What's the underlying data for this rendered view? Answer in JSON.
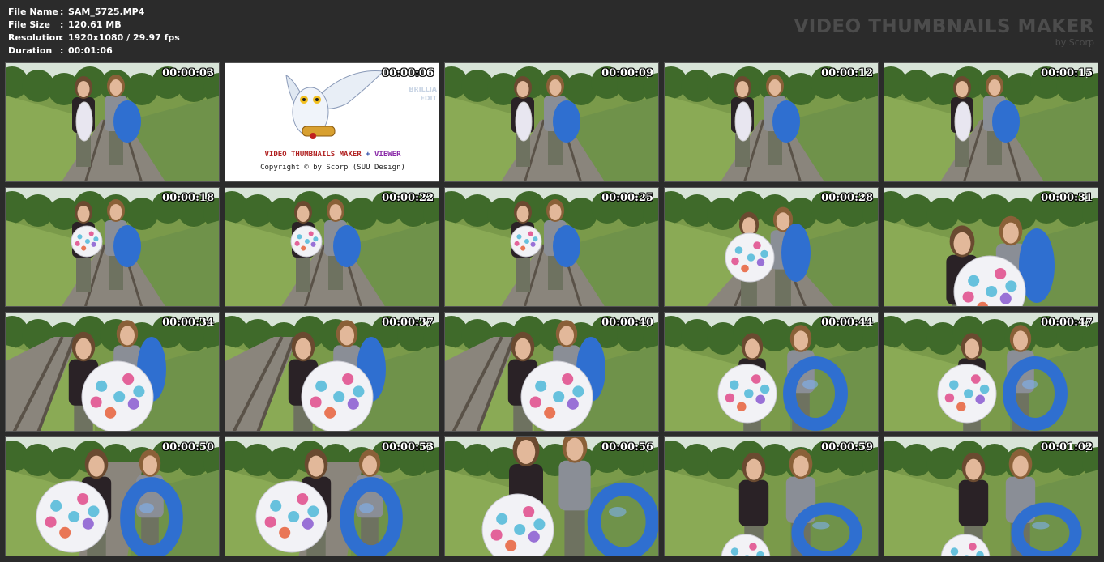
{
  "header": {
    "info": [
      {
        "key": "File Name",
        "sep": ":",
        "value": "SAM_5725.MP4"
      },
      {
        "key": "File Size",
        "sep": ":",
        "value": "120.61 MB"
      },
      {
        "key": "Resolution",
        "sep": ":",
        "value": "1920x1080 / 29.97 fps"
      },
      {
        "key": "Duration",
        "sep": ":",
        "value": "00:01:06"
      }
    ],
    "brand_title": "VIDEO THUMBNAILS MAKER",
    "brand_sub": "by Scorp"
  },
  "logo_tile": {
    "title_part1": "VIDEO THUMBNAILS MAKER",
    "title_part2": "+",
    "title_part3": "VIEWER",
    "copyright": "Copyright © by Scorp (SUU Design)",
    "faint_line1": "BRILLIA",
    "faint_line2": "EDIT"
  },
  "colors": {
    "background": "#2b2b2b",
    "grass": "#7a9a4a",
    "tree": "#3f6a2a",
    "sky": "#d8e4d8",
    "rail": "#5a5248",
    "gravel": "#8a857c",
    "blue_ring": "#2f6fd0",
    "ball": "#f2f2f6",
    "hair": "#6a4a30",
    "dark_top": "#2a2226",
    "grey_top": "#8a8e96"
  },
  "thumbnails": [
    {
      "timestamp": "00:00:03",
      "scene": "stand"
    },
    {
      "timestamp": "00:00:06",
      "scene": "logo"
    },
    {
      "timestamp": "00:00:09",
      "scene": "stand"
    },
    {
      "timestamp": "00:00:12",
      "scene": "stand"
    },
    {
      "timestamp": "00:00:15",
      "scene": "stand"
    },
    {
      "timestamp": "00:00:18",
      "scene": "stand-ball"
    },
    {
      "timestamp": "00:00:22",
      "scene": "stand-ball"
    },
    {
      "timestamp": "00:00:25",
      "scene": "stand-ball"
    },
    {
      "timestamp": "00:00:28",
      "scene": "close"
    },
    {
      "timestamp": "00:00:31",
      "scene": "closer"
    },
    {
      "timestamp": "00:00:34",
      "scene": "tracks-close"
    },
    {
      "timestamp": "00:00:37",
      "scene": "tracks-close"
    },
    {
      "timestamp": "00:00:40",
      "scene": "tracks-close"
    },
    {
      "timestamp": "00:00:44",
      "scene": "grass-close"
    },
    {
      "timestamp": "00:00:47",
      "scene": "grass-close"
    },
    {
      "timestamp": "00:00:50",
      "scene": "grass-ball"
    },
    {
      "timestamp": "00:00:53",
      "scene": "grass-ball"
    },
    {
      "timestamp": "00:00:56",
      "scene": "ring-low"
    },
    {
      "timestamp": "00:00:59",
      "scene": "ring-far"
    },
    {
      "timestamp": "00:01:02",
      "scene": "ring-far"
    }
  ]
}
